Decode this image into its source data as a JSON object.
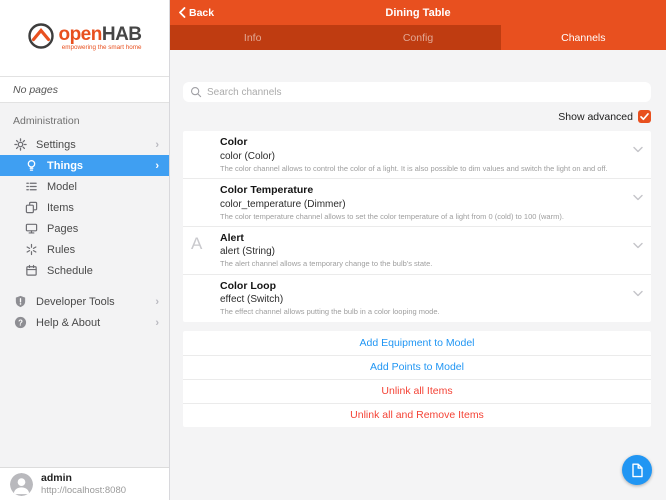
{
  "colors": {
    "primary": "#e8501f",
    "tab_inactive_bg": "#bf3c11",
    "selected_blue": "#3f9ff2",
    "link_blue": "#2196f3",
    "danger_red": "#f44336"
  },
  "sidebar": {
    "logo": {
      "word_open": "open",
      "word_hab": "HAB",
      "tagline": "empowering the smart home"
    },
    "no_pages": "No pages",
    "section_label": "Administration",
    "items": [
      {
        "label": "Settings",
        "icon": "gear-icon"
      },
      {
        "label": "Things",
        "icon": "lightbulb-icon"
      },
      {
        "label": "Model",
        "icon": "model-tree-icon"
      },
      {
        "label": "Items",
        "icon": "items-copy-icon"
      },
      {
        "label": "Pages",
        "icon": "monitor-icon"
      },
      {
        "label": "Rules",
        "icon": "sparkle-icon"
      },
      {
        "label": "Schedule",
        "icon": "calendar-icon"
      },
      {
        "label": "Developer Tools",
        "icon": "shield-icon"
      },
      {
        "label": "Help & About",
        "icon": "question-icon"
      }
    ],
    "user": {
      "name": "admin",
      "url": "http://localhost:8080"
    }
  },
  "header": {
    "back_label": "Back",
    "title": "Dining Table",
    "tabs": [
      {
        "label": "Info"
      },
      {
        "label": "Config"
      },
      {
        "label": "Channels"
      }
    ]
  },
  "content": {
    "search_placeholder": "Search channels",
    "show_advanced_label": "Show advanced",
    "channels": [
      {
        "title": "Color",
        "subtitle": "color (Color)",
        "description": "The color channel allows to control the color of a light. It is also possible to dim values and switch the light on and off.",
        "icon": "color-wheel-icon"
      },
      {
        "title": "Color Temperature",
        "subtitle": "color_temperature (Dimmer)",
        "description": "The color temperature channel allows to set the color temperature of a light from 0 (cold) to 100 (warm).",
        "icon": "color-wheel-icon"
      },
      {
        "title": "Alert",
        "subtitle": "alert (String)",
        "description": "The alert channel allows a temporary change to the bulb's state.",
        "icon": "letter-a-icon",
        "icon_letter": "A"
      },
      {
        "title": "Color Loop",
        "subtitle": "effect (Switch)",
        "description": "The effect channel allows putting the bulb in a color looping mode.",
        "icon": "color-wheel-icon"
      }
    ],
    "actions": [
      {
        "label": "Add Equipment to Model",
        "color": "blue"
      },
      {
        "label": "Add Points to Model",
        "color": "blue"
      },
      {
        "label": "Unlink all Items",
        "color": "red"
      },
      {
        "label": "Unlink all and Remove Items",
        "color": "red"
      }
    ]
  }
}
